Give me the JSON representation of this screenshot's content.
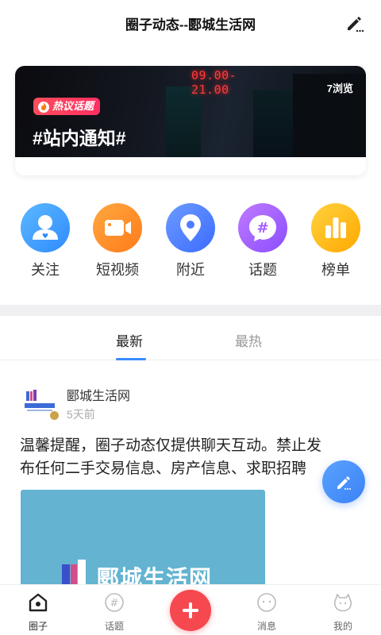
{
  "header": {
    "title": "圈子动态--郾城生活网",
    "edit_icon": "edit-pencil-icon"
  },
  "banner": {
    "neon_text": "09.00-21.00",
    "views": "7浏览",
    "tag": "热议话题",
    "topic": "#站内通知#"
  },
  "quick_links": [
    {
      "label": "关注",
      "icon": "follow-user-icon",
      "color": "#3b9cff"
    },
    {
      "label": "短视频",
      "icon": "video-icon",
      "color": "#ff8a1f"
    },
    {
      "label": "附近",
      "icon": "location-pin-icon",
      "color": "#4f7cff"
    },
    {
      "label": "话题",
      "icon": "hashtag-chat-icon",
      "color": "#a35cff"
    },
    {
      "label": "榜单",
      "icon": "ranking-bars-icon",
      "color": "#ffb400"
    }
  ],
  "tabs": {
    "latest": "最新",
    "hot": "最热"
  },
  "post": {
    "author": "郾城生活网",
    "time": "5天前",
    "content_line1": "温馨提醒，圈子动态仅提供聊天互动。禁止发",
    "content_line2": "布任何二手交易信息、房产信息、求职招聘",
    "image_logo_text": "郾城生活网"
  },
  "bottom_nav": {
    "circle": "圈子",
    "topics": "话题",
    "messages": "消息",
    "mine": "我的"
  },
  "colors": {
    "accent_blue": "#3a8bff",
    "plus_red": "#f5494f",
    "hot_tag_red": "#ff3a5c"
  }
}
